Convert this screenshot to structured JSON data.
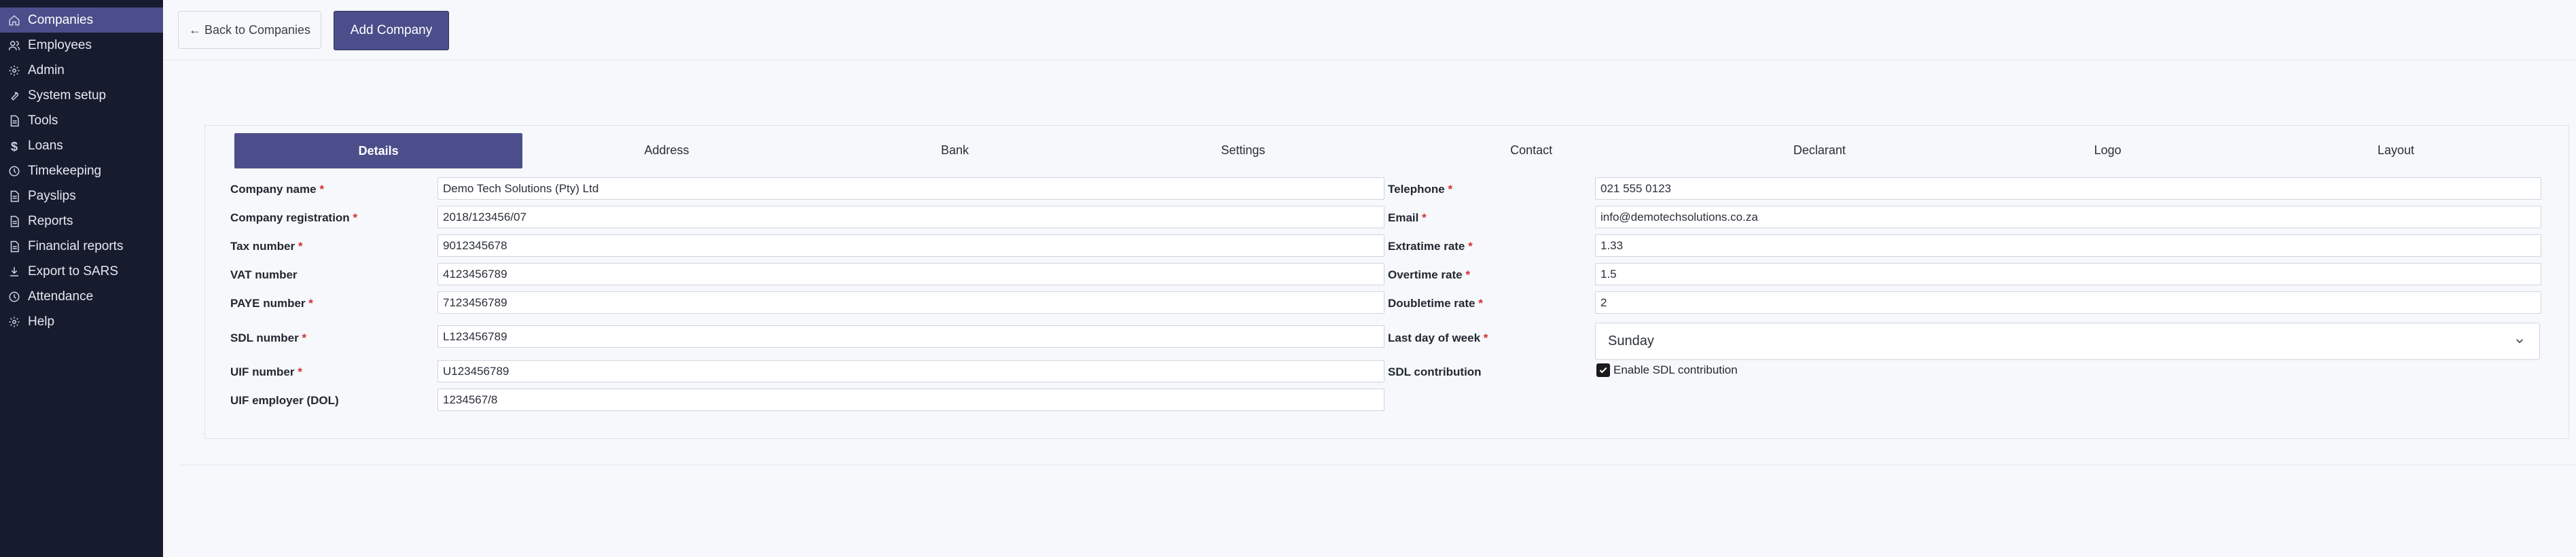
{
  "sidebar": {
    "items": [
      {
        "label": "Companies",
        "icon": "home-icon",
        "active": true
      },
      {
        "label": "Employees",
        "icon": "users-icon"
      },
      {
        "label": "Admin",
        "icon": "gear-icon"
      },
      {
        "label": "System setup",
        "icon": "wrench-icon"
      },
      {
        "label": "Tools",
        "icon": "document-icon"
      },
      {
        "label": "Loans",
        "icon": "dollar-icon"
      },
      {
        "label": "Timekeeping",
        "icon": "clock-icon"
      },
      {
        "label": "Payslips",
        "icon": "document-icon"
      },
      {
        "label": "Reports",
        "icon": "document-icon"
      },
      {
        "label": "Financial reports",
        "icon": "document-icon"
      },
      {
        "label": "Export to SARS",
        "icon": "download-icon"
      },
      {
        "label": "Attendance",
        "icon": "clock-icon"
      },
      {
        "label": "Help",
        "icon": "gear-icon"
      }
    ]
  },
  "toolbar": {
    "back_label": "← Back to Companies",
    "add_label": "Add Company"
  },
  "tabs": [
    "Details",
    "Address",
    "Bank",
    "Settings",
    "Contact",
    "Declarant",
    "Logo",
    "Layout"
  ],
  "active_tab": "Details",
  "form": {
    "left": [
      {
        "label": "Company name",
        "required": "*",
        "value": "Demo Tech Solutions (Pty) Ltd"
      },
      {
        "label": "Company registration",
        "required": "*",
        "value": "2018/123456/07"
      },
      {
        "label": "Tax number",
        "required": "*",
        "value": "9012345678"
      },
      {
        "label": "VAT number",
        "required": "",
        "value": "4123456789"
      },
      {
        "label": "PAYE number",
        "required": "*",
        "value": "7123456789"
      },
      {
        "label": "SDL number",
        "required": "*",
        "value": "L123456789"
      },
      {
        "label": "UIF number",
        "required": "*",
        "value": "U123456789"
      },
      {
        "label": "UIF employer (DOL)",
        "required": "",
        "value": "1234567/8"
      }
    ],
    "right": [
      {
        "label": "Telephone",
        "required": "*",
        "value": "021 555 0123"
      },
      {
        "label": "Email",
        "required": "*",
        "value": "info@demotechsolutions.co.za"
      },
      {
        "label": "Extratime rate",
        "required": "*",
        "value": "1.33"
      },
      {
        "label": "Overtime rate",
        "required": "*",
        "value": "1.5"
      },
      {
        "label": "Doubletime rate",
        "required": "*",
        "value": "2"
      },
      {
        "label": "Last day of week",
        "required": "*",
        "value": "Sunday"
      },
      {
        "label": "SDL contribution",
        "required": "",
        "checkbox_label": "Enable SDL contribution",
        "checked": true
      }
    ]
  },
  "colors": {
    "accent": "#4b4e8a",
    "sidebar_bg": "#171b2e",
    "required": "#d32f2f"
  }
}
